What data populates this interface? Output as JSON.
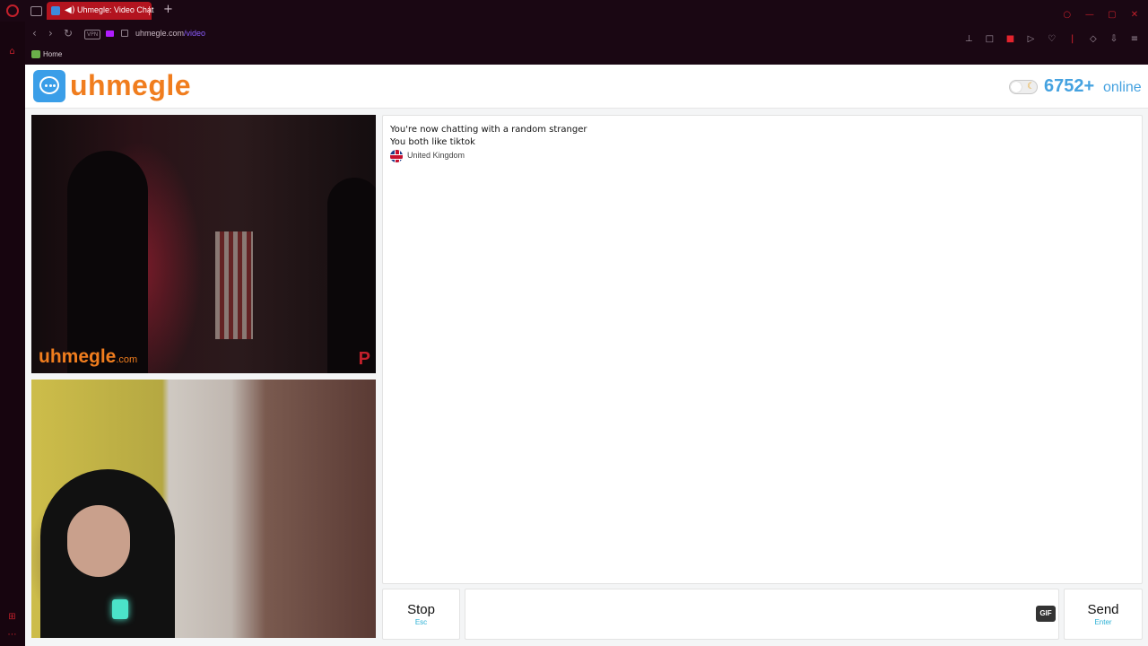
{
  "browser": {
    "tab_title": "Uhmegle: Video Chat",
    "new_tab_symbol": "+",
    "vpn_label": "VPN",
    "url_host": "uhmegle.com",
    "url_path": "/video",
    "bookmark_label": "Home",
    "accent_color": "#c2202b",
    "icons": [
      "opera-icon",
      "tab-overview-icon",
      "speaker-icon",
      "back-icon",
      "forward-icon",
      "reload-icon",
      "lock-icon",
      "camera-icon",
      "pin-icon",
      "snapshot-icon",
      "adblock-icon",
      "play-icon",
      "heart-icon",
      "extensions-icon",
      "download-icon",
      "menu-icon"
    ]
  },
  "header": {
    "logo_text": "uhmegle",
    "online_count": "6752+",
    "online_label": "online",
    "brand_color": "#f07d1e",
    "online_color": "#45a2e0"
  },
  "videos": {
    "watermark": "uhmegle",
    "watermark_suffix": ".com",
    "report_symbol": "P"
  },
  "chat": {
    "lines": [
      "You're now chatting with a random stranger",
      "You both like tiktok"
    ],
    "country": "United Kingdom"
  },
  "controls": {
    "stop_label": "Stop",
    "stop_hint": "Esc",
    "send_label": "Send",
    "send_hint": "Enter",
    "gif_label": "GIF",
    "message_value": ""
  }
}
